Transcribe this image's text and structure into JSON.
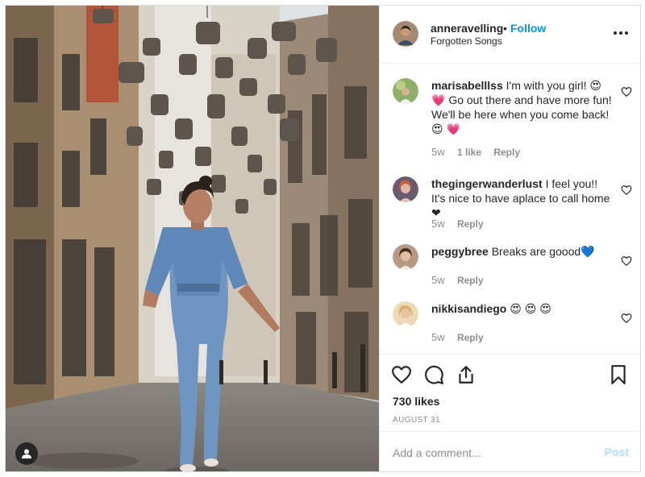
{
  "post": {
    "username": "anneravelling",
    "separator": "•",
    "follow_label": "Follow",
    "location": "Forgotten Songs"
  },
  "comments": [
    {
      "username": "marisabelllss",
      "text": "I'm with you girl! 😍 💗  Go out there and have more fun! We'll be here when you come back! 😍 💗",
      "time": "5w",
      "likes": "1 like",
      "reply_label": "Reply"
    },
    {
      "username": "thegingerwanderlust",
      "text": "I feel you!! It's nice to have aplace to call home ❤",
      "time": "5w",
      "reply_label": "Reply"
    },
    {
      "username": "peggybree",
      "text": "Breaks are goood💙",
      "time": "5w",
      "reply_label": "Reply"
    },
    {
      "username": "nikkisandiego",
      "text": "😍 😍 😍",
      "time": "5w",
      "reply_label": "Reply"
    }
  ],
  "actions": {
    "like_icon": "heart-icon",
    "comment_icon": "comment-icon",
    "share_icon": "share-icon",
    "save_icon": "bookmark-icon",
    "likes_count": "730 likes",
    "date": "AUGUST 31"
  },
  "add_comment": {
    "placeholder": "Add a comment...",
    "post_label": "Post"
  },
  "colors": {
    "accent": "#0095f6",
    "post_disabled": "#b2dffc",
    "text": "#262626",
    "muted": "#8e8e8e",
    "border": "#dbdbdb"
  }
}
